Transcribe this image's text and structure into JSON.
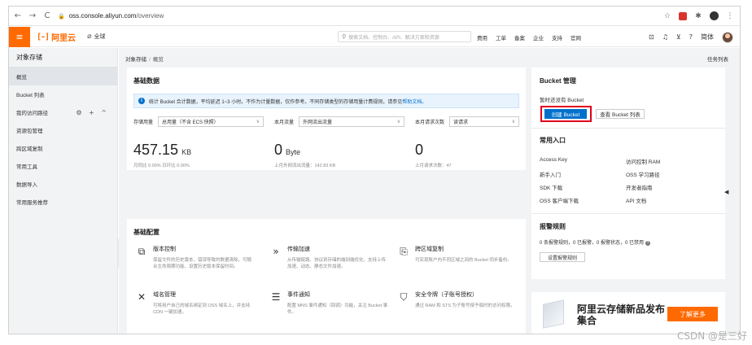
{
  "browser": {
    "url_domain": "oss.console.aliyun.com",
    "url_path": "/overview",
    "back_icon": "←",
    "forward_icon": "→",
    "reload_icon": "C"
  },
  "topbar": {
    "brand": "阿里云",
    "region": "全球",
    "search_placeholder": "搜索文档、控制台、API、解决方案和资源",
    "nav": [
      "费用",
      "工单",
      "备案",
      "企业",
      "支持",
      "官网"
    ],
    "lang": "简体"
  },
  "sidebar": {
    "title": "对象存储",
    "items": [
      "概览",
      "Bucket 列表",
      "我的访问路径",
      "资源包管理",
      "跨区域复制",
      "常用工具",
      "数据导入",
      "常用服务推荐"
    ],
    "path_ops": "⚙ + ^"
  },
  "main": {
    "breadcrumb_root": "对象存储",
    "breadcrumb_sep": "/",
    "breadcrumb_current": "概览",
    "task_list": "任务列表"
  },
  "basic_data": {
    "title": "基础数据",
    "notice_text": "统计 Bucket 合计数据，平均延迟 1~3 小时。不作为计量数据，仅作参考。不同存储类型的存储用量计费规则，请参见",
    "notice_link": "帮助文档。",
    "metrics": [
      {
        "label": "存储用量",
        "select": "总用量（不含 ECS 快照）",
        "value": "457.15",
        "unit": "KB",
        "sub": "月同比 0.00%  日环比 0.00%"
      },
      {
        "label": "本月流量",
        "select": "外网流出流量",
        "value": "0",
        "unit": "Byte",
        "sub": "上月外网流出流量：142.83 KB"
      },
      {
        "label": "本月请求次数",
        "select": "读请求",
        "value": "0",
        "unit": "",
        "sub": "上月请求次数：47"
      }
    ]
  },
  "basic_config": {
    "title": "基础配置",
    "features": [
      {
        "title": "版本控制",
        "desc": "保留文件的历史版本，错误导致的数据清除，可随合生命周期功能，设置历史版本保留时间。"
      },
      {
        "title": "传输加速",
        "desc": "从传输链路、协议到存储的端到端优化，支持上传加速、动态、静态文件加速。"
      },
      {
        "title": "跨区域复制",
        "desc": "可实现账户内不同区域之间的 Bucket 同步备份。"
      },
      {
        "title": "域名管理",
        "desc": "可将用户自己的域名绑定到 OSS 域名上，并支持 CDN 一键加速。"
      },
      {
        "title": "事件通知",
        "desc": "配置 MNS 事件通知（回调）功能，关注 Bucket 事件。"
      },
      {
        "title": "安全令牌（子账号授权）",
        "desc": "通过 RAM 和 STS 为子账号授予临时的访问权限。"
      }
    ]
  },
  "bucket_mgmt": {
    "title": "Bucket 管理",
    "empty_text": "暂时还没有 Bucket",
    "create_button": "创建 Bucket",
    "list_button": "查看 Bucket 列表",
    "entries_title": "常用入口",
    "entries": [
      "Access Key",
      "访问控制 RAM",
      "新手入门",
      "OSS 学习路径",
      "SDK 下载",
      "开发者指南",
      "OSS 客户端下载",
      "API 文档"
    ],
    "alarm_title": "报警规则",
    "alarm_text": "0 条报警规则，0 已报警，0 报警状态，0 已禁用",
    "alarm_button": "设置报警规则"
  },
  "promo": {
    "title": "阿里云存储新品发布集合",
    "button": "了解更多"
  },
  "watermark": "CSDN @是三好"
}
